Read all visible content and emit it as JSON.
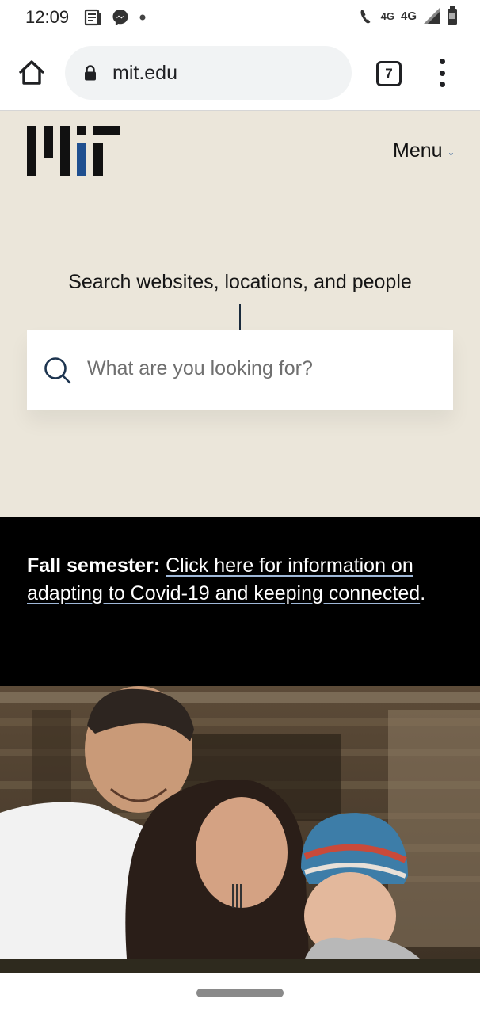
{
  "status_bar": {
    "time": "12:09",
    "network_small": "4G",
    "network_big": "4G",
    "icons": [
      "news-icon",
      "messenger-icon",
      "notification-dot-icon",
      "wifi-calling-icon",
      "signal-icon",
      "battery-icon"
    ]
  },
  "browser": {
    "url": "mit.edu",
    "tab_count": "7",
    "icons": [
      "home-icon",
      "lock-icon",
      "more-vert-icon"
    ]
  },
  "hero": {
    "menu_label": "Menu",
    "menu_arrow": "↓",
    "search_heading": "Search websites, locations, and people",
    "search_placeholder": "What are you looking for?",
    "background_color": "#ebe6da",
    "logo_accent": "#1f4f8f"
  },
  "announcement": {
    "bold_label": "Fall semester:",
    "link_text": "Click here for information on adapting to Covid-19 and keeping connected",
    "trailing": "."
  },
  "colors": {
    "announcement_bg": "#000000",
    "link_underline": "#9fb8d8"
  }
}
